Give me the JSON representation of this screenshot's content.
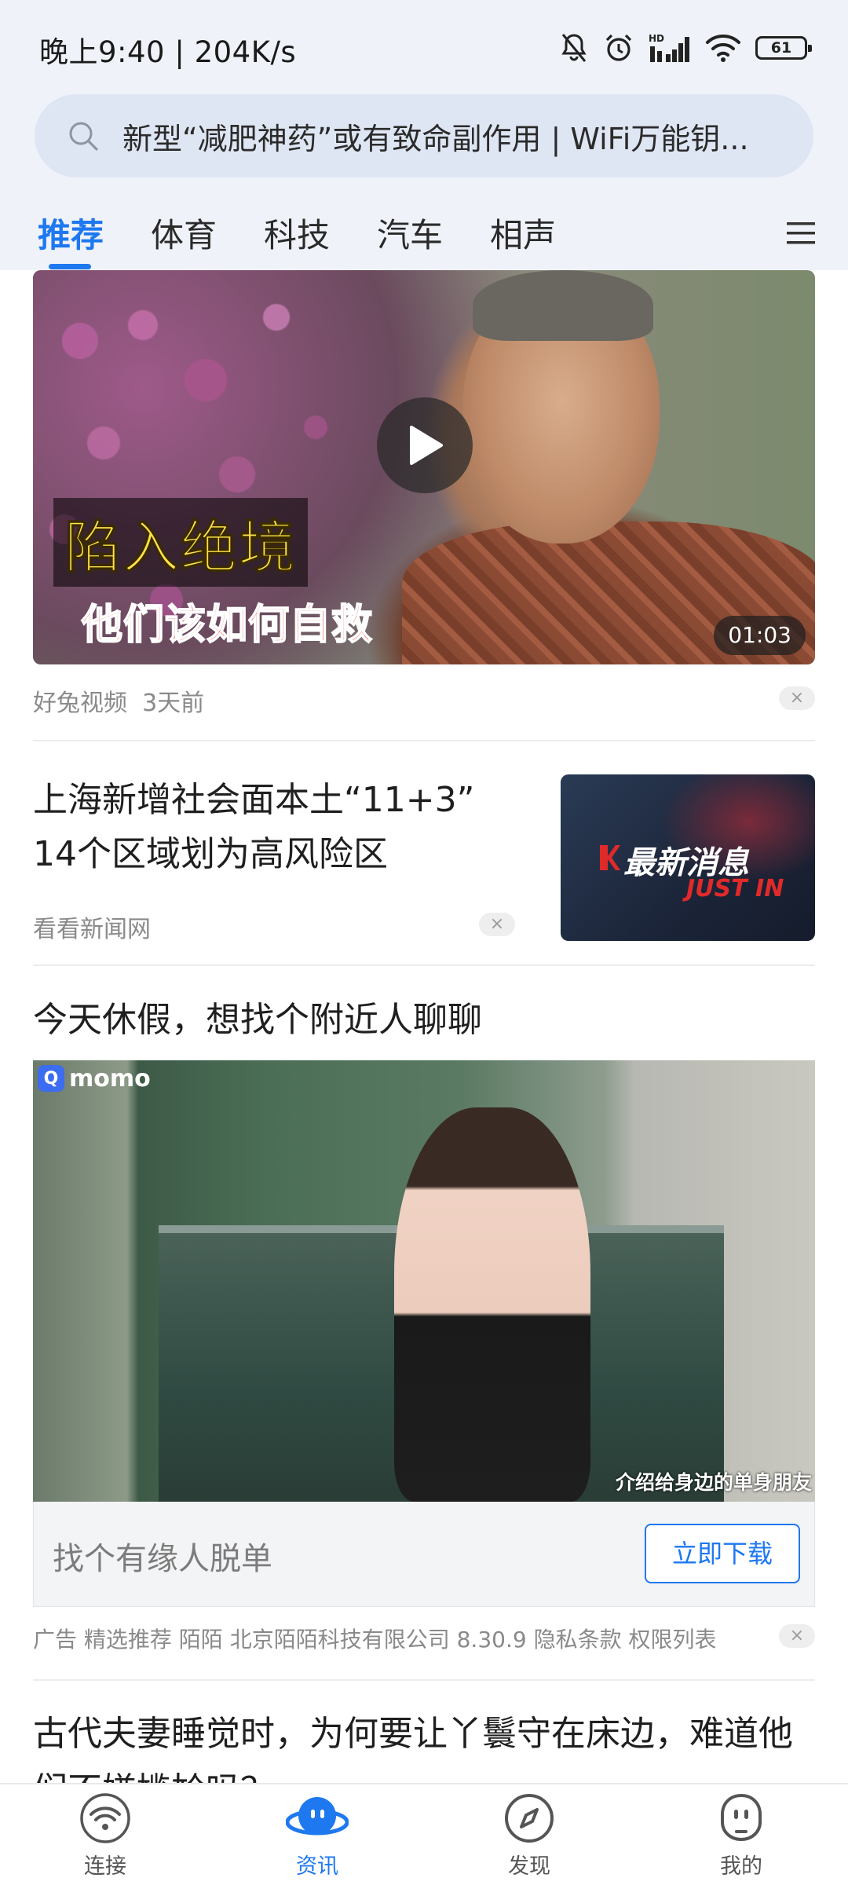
{
  "status_bar": {
    "time": "晚上9:40 | 204K/s",
    "battery": "61",
    "icons": [
      "mute-bell-icon",
      "alarm-icon",
      "hd-signal-icon",
      "wifi-icon",
      "battery-icon"
    ]
  },
  "search": {
    "text": "新型“减肥神药”或有致命副作用 | WiFi万能钥..."
  },
  "tabs": [
    {
      "label": "推荐",
      "active": true
    },
    {
      "label": "体育",
      "active": false
    },
    {
      "label": "科技",
      "active": false
    },
    {
      "label": "汽车",
      "active": false
    },
    {
      "label": "相声",
      "active": false
    }
  ],
  "feed": {
    "video": {
      "overlay_line1": "陷入绝境",
      "overlay_line2": "他们该如何自救",
      "duration": "01:03",
      "source": "好兔视频",
      "time": "3天前",
      "close": "×"
    },
    "news": {
      "title": "上海新增社会面本土“11+3” 14个区域划为高风险区",
      "source": "看看新闻网",
      "close": "×",
      "thumb_text1": "最新消息",
      "thumb_text2": "JUST IN"
    },
    "ad": {
      "title": "今天休假，想找个附近人聊聊",
      "logo_text": "momo",
      "image_caption": "介绍给身边的单身朋友",
      "cta_text": "找个有缘人脱单",
      "cta_button": "立即下载",
      "meta": "广告  精选推荐  陌陌  北京陌陌科技有限公司  8.30.9  隐私条款  权限列表",
      "close": "×"
    },
    "next": {
      "title": "古代夫妻睡觉时，为何要让丫鬟守在床边，难道他们不嫌尴尬吗？"
    }
  },
  "bottom_nav": [
    {
      "label": "连接",
      "icon": "wifi-icon",
      "active": false
    },
    {
      "label": "资讯",
      "icon": "news-mascot-icon",
      "active": true
    },
    {
      "label": "发现",
      "icon": "compass-icon",
      "active": false
    },
    {
      "label": "我的",
      "icon": "profile-face-icon",
      "active": false
    }
  ],
  "colors": {
    "accent": "#1e78f0",
    "header_bg": "#eff2f8",
    "search_bg": "#dfe6f3"
  }
}
